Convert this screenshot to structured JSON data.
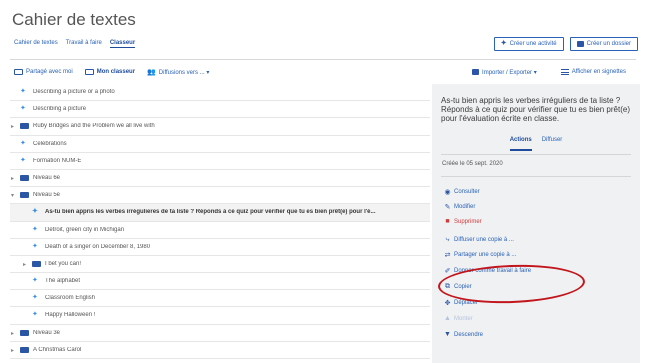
{
  "app": {
    "title": "Cahier de textes"
  },
  "top_tabs": [
    {
      "label": "Cahier de textes",
      "active": false
    },
    {
      "label": "Travail à faire",
      "active": false
    },
    {
      "label": "Classeur",
      "active": true
    }
  ],
  "top_actions": [
    {
      "label": "Créer une activité",
      "icon": "star-plus-icon"
    },
    {
      "label": "Créer un dossier",
      "icon": "folder-plus-icon"
    }
  ],
  "toolbar": {
    "shared_with_me": "Partagé avec moi",
    "my_binder": "Mon classeur",
    "broadcasts": "Diffusions vers ... ▾",
    "import_export": "Importer / Exporter ▾",
    "show_tabs": "Afficher en signettes"
  },
  "rows": [
    {
      "label": "Describing a picture or a photo",
      "type": "activity",
      "level": 0,
      "selected": false
    },
    {
      "label": "Describing a picture",
      "type": "activity",
      "level": 0,
      "selected": false
    },
    {
      "label": "Ruby Bridges and the Problem we all live with",
      "type": "folder",
      "level": 0,
      "collapsed": true,
      "selected": false
    },
    {
      "label": "Celebrations",
      "type": "activity",
      "level": 0,
      "selected": false
    },
    {
      "label": "Formation NUM-E",
      "type": "activity",
      "level": 0,
      "selected": false
    },
    {
      "label": "Niveau 6e",
      "type": "folder",
      "level": 0,
      "collapsed": true,
      "selected": false
    },
    {
      "label": "Niveau 5e",
      "type": "folder",
      "level": 0,
      "collapsed": false,
      "selected": false
    },
    {
      "label": "As-tu bien appris les verbes irrégulieres de ta liste ? Réponds à ce quiz pour vérifier que tu es bien prêt(e) pour l'é...",
      "type": "activity",
      "level": 1,
      "selected": true
    },
    {
      "label": "Detroit, green city in Michigan",
      "type": "activity",
      "level": 1,
      "selected": false
    },
    {
      "label": "Death of a singer on December 8, 1980",
      "type": "activity",
      "level": 1,
      "selected": false
    },
    {
      "label": "I bet you can!",
      "type": "folder",
      "level": 1,
      "collapsed": true,
      "selected": false
    },
    {
      "label": "The alphabet",
      "type": "activity",
      "level": 1,
      "selected": false
    },
    {
      "label": "Classroom English",
      "type": "activity",
      "level": 1,
      "selected": false
    },
    {
      "label": "Happy Halloween !",
      "type": "activity",
      "level": 1,
      "selected": false
    },
    {
      "label": "Niveau 3e",
      "type": "folder",
      "level": 0,
      "collapsed": true,
      "selected": false
    },
    {
      "label": "A Christmas Carol",
      "type": "folder",
      "level": 0,
      "collapsed": true,
      "selected": false
    },
    {
      "label": "Sherlock Holmes",
      "type": "folder",
      "level": 0,
      "collapsed": true,
      "selected": false
    }
  ],
  "side_panel": {
    "title": "As-tu bien appris les verbes irréguliers de ta liste ? Réponds à ce quiz pour vérifier que tu es bien prêt(e) pour l'évaluation écrite en classe.",
    "tabs": [
      {
        "label": "Actions",
        "active": true
      },
      {
        "label": "Diffuser",
        "active": false
      }
    ],
    "created": "Créée le 05 sept. 2020",
    "actions": [
      {
        "label": "Consulter",
        "icon": "eye-icon",
        "glyph": "◉",
        "state": "normal"
      },
      {
        "label": "Modifier",
        "icon": "pencil-icon",
        "glyph": "✎",
        "state": "normal"
      },
      {
        "label": "Supprimer",
        "icon": "trash-icon",
        "glyph": "■",
        "state": "danger"
      },
      {
        "label": "Diffuser une copie à ...",
        "icon": "share-icon",
        "glyph": "⤷",
        "state": "normal"
      },
      {
        "label": "Partager une copie à ...",
        "icon": "share-copy-icon",
        "glyph": "⇄",
        "state": "normal"
      },
      {
        "label": "Donner comme travail à faire",
        "icon": "assign-icon",
        "glyph": "✐",
        "state": "normal"
      },
      {
        "label": "Copier",
        "icon": "copy-icon",
        "glyph": "⧉",
        "state": "normal"
      },
      {
        "label": "Déplacer",
        "icon": "move-icon",
        "glyph": "✥",
        "state": "normal"
      },
      {
        "label": "Monter",
        "icon": "arrow-up-icon",
        "glyph": "▲",
        "state": "disabled"
      },
      {
        "label": "Descendre",
        "icon": "arrow-down-icon",
        "glyph": "▼",
        "state": "normal"
      }
    ]
  },
  "colors": {
    "accent": "#2a62b7",
    "folder": "#2b56a6",
    "activity": "#3b8de0",
    "danger": "#cf3b3b",
    "highlight": "#c2161d"
  }
}
